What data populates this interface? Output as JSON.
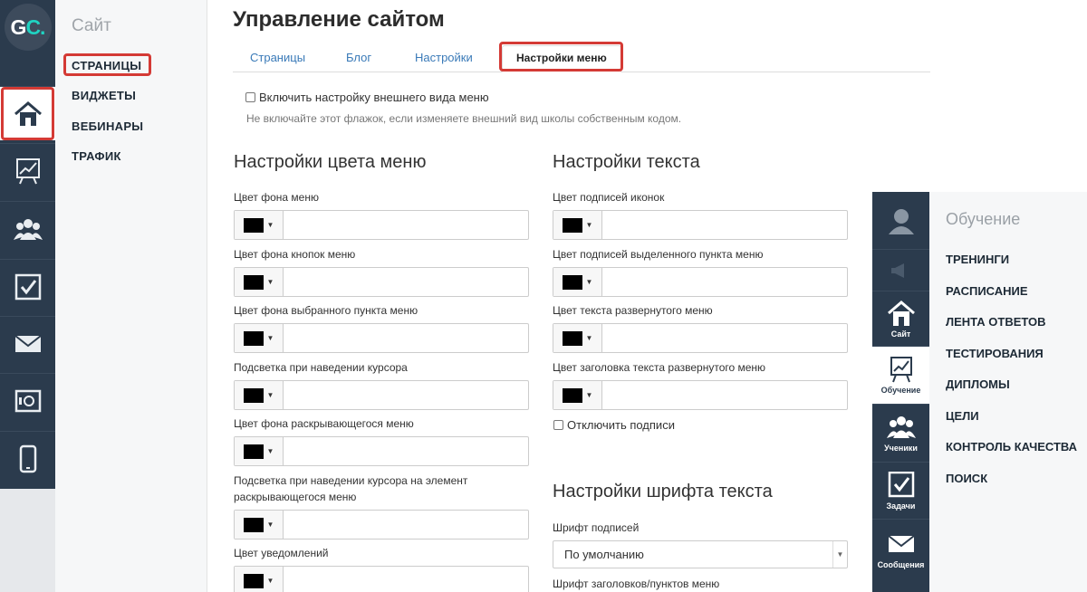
{
  "logo": {
    "text_main": "G",
    "text_accent": "C."
  },
  "rail_icons": [
    "home-icon",
    "chart-icon",
    "users-icon",
    "tasks-icon",
    "mail-icon",
    "safe-icon",
    "mobile-icon"
  ],
  "subnav": {
    "title": "Сайт",
    "items": [
      "СТРАНИЦЫ",
      "ВИДЖЕТЫ",
      "ВЕБИНАРЫ",
      "ТРАФИК"
    ]
  },
  "main": {
    "title": "Управление сайтом",
    "tabs": [
      "Страницы",
      "Блог",
      "Настройки",
      "Настройки меню"
    ],
    "enable_checkbox": "Включить настройку внешнего вида меню",
    "enable_hint": "Не включайте этот флажок, если изменяете внешний вид школы собственным кодом."
  },
  "color_section": {
    "heading": "Настройки цвета меню",
    "fields": [
      "Цвет фона меню",
      "Цвет фона кнопок меню",
      "Цвет фона выбранного пункта меню",
      "Подсветка при наведении курсора",
      "Цвет фона раскрывающегося меню",
      "Подсветка при наведении курсора на элемент",
      "раскрывающегося меню",
      "Цвет уведомлений"
    ],
    "swatch_color": "#000000"
  },
  "text_section": {
    "heading": "Настройки текста",
    "fields": [
      "Цвет подписей иконок",
      "Цвет подписей выделенного пункта меню",
      "Цвет текста развернутого меню",
      "Цвет заголовка текста развернутого меню"
    ],
    "disable_labels": "Отключить подписи"
  },
  "font_section": {
    "heading": "Настройки шрифта текста",
    "caption_font_label": "Шрифт подписей",
    "caption_font_value": "По умолчанию",
    "headers_font_label": "Шрифт заголовков/пунктов меню"
  },
  "preview": {
    "rail": [
      "Сайт",
      "Обучение",
      "Ученики",
      "Задачи",
      "Сообщения"
    ],
    "title": "Обучение",
    "items": [
      "ТРЕНИНГИ",
      "РАСПИСАНИЕ",
      "ЛЕНТА ОТВЕТОВ",
      "ТЕСТИРОВАНИЯ",
      "ДИПЛОМЫ",
      "ЦЕЛИ",
      "КОНТРОЛЬ КАЧЕСТВА",
      "ПОИСК"
    ]
  },
  "colors": {
    "sidebar": "#2b3b4d",
    "accent": "#20d3c2",
    "highlight": "#d43a35",
    "link": "#3a7ab8"
  }
}
